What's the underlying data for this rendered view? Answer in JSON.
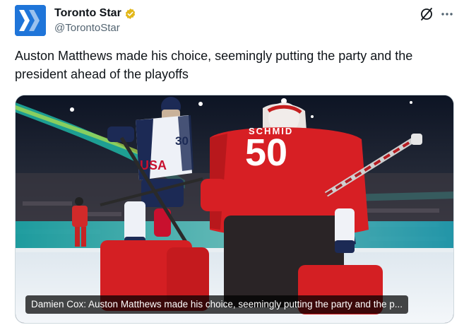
{
  "account": {
    "display_name": "Toronto Star",
    "handle": "@TorontoStar",
    "avatar_icon": "toronto-star-logo",
    "verified_icon": "gold-verified-badge-icon",
    "brand_color": "#1f75d9",
    "verified_color": "#e2b719"
  },
  "actions": {
    "grok_icon": "grok-icon",
    "more_icon": "more-options-icon"
  },
  "tweet": {
    "text": "Auston Matthews made his choice, seemingly putting the party and the president ahead of the playoffs"
  },
  "media": {
    "alt": "",
    "caption": "Damien Cox: Auston Matthews made his choice, seemingly putting the party and the p...",
    "jersey_player": "30",
    "jersey_goalie": "50",
    "jersey_player_letters": "USA"
  }
}
